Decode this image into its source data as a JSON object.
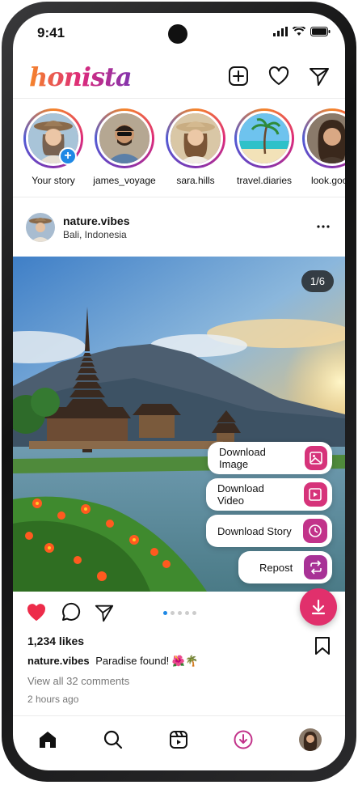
{
  "status": {
    "time": "9:41"
  },
  "app": {
    "logo": "honista"
  },
  "stories": [
    {
      "name": "Your story"
    },
    {
      "name": "james_voyage"
    },
    {
      "name": "sara.hills"
    },
    {
      "name": "travel.diaries"
    },
    {
      "name": "look.good"
    }
  ],
  "post": {
    "username": "nature.vibes",
    "location": "Bali, Indonesia",
    "counter": "1/6",
    "likes": "1,234 likes",
    "caption_user": "nature.vibes",
    "caption_text": "Paradise found! 🌺🌴",
    "comments": "View all 32 comments",
    "time_ago": "2 hours ago"
  },
  "menu": {
    "download_image": "Download Image",
    "download_video": "Download Video",
    "download_story": "Download Story",
    "repost": "Repost"
  },
  "colors": {
    "accent": "#e1306c",
    "blue": "#1e88e5"
  },
  "icons": [
    "add-post-icon",
    "heart-icon",
    "send-icon",
    "home-icon",
    "search-icon",
    "reels-icon",
    "download-icon"
  ]
}
